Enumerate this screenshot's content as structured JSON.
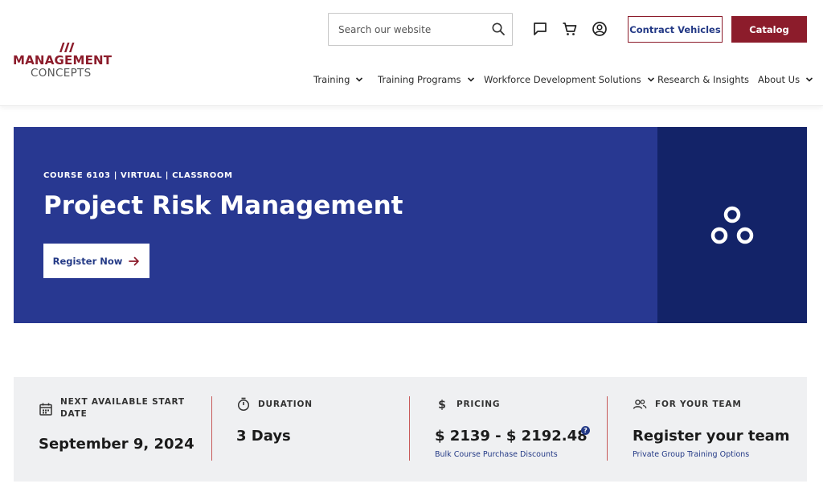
{
  "brand": {
    "line1": "MANAGEMENT",
    "line2": "CONCEPTS",
    "color": "#8c1c2b"
  },
  "header": {
    "search_placeholder": "Search our website",
    "icons": [
      "chat-icon",
      "cart-icon",
      "account-icon"
    ],
    "contract_label": "Contract Vehicles",
    "catalog_label": "Catalog"
  },
  "nav": {
    "items": [
      {
        "label": "Training",
        "dropdown": true
      },
      {
        "label": "Training Programs",
        "dropdown": true
      },
      {
        "label": "Workforce Development Solutions",
        "dropdown": true
      },
      {
        "label": "Research & Insights",
        "dropdown": false
      },
      {
        "label": "About Us",
        "dropdown": true
      }
    ]
  },
  "hero": {
    "eyebrow": "COURSE 6103 | VIRTUAL | CLASSROOM",
    "title": "Project Risk Management",
    "cta_label": "Register Now",
    "bg_color": "#283891",
    "side_color": "#132368"
  },
  "info": {
    "start": {
      "label": "NEXT AVAILABLE START DATE",
      "value": "September 9, 2024",
      "icon": "calendar-icon"
    },
    "duration": {
      "label": "DURATION",
      "value": "3 Days",
      "icon": "stopwatch-icon"
    },
    "pricing": {
      "label": "PRICING",
      "value": "$ 2139 - $ 2192.48",
      "link": "Bulk Course Purchase Discounts",
      "icon": "dollar-icon",
      "help": "?"
    },
    "team": {
      "label": "FOR YOUR TEAM",
      "value": "Register your team",
      "link": "Private Group Training Options",
      "icon": "group-icon"
    }
  }
}
